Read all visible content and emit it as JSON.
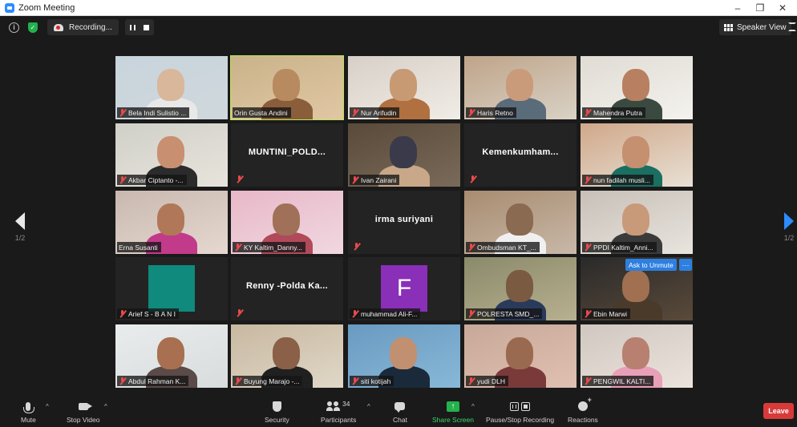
{
  "window": {
    "title": "Zoom Meeting",
    "minimize_icon": "–",
    "maximize_icon": "❐",
    "close_icon": "✕"
  },
  "topbar": {
    "recording_text": "Recording...",
    "speaker_view_label": "Speaker View"
  },
  "pager": {
    "left_page": "1/2",
    "right_page": "1/2"
  },
  "participants": [
    {
      "name": "Bela Indi Sulistio ...",
      "type": "video",
      "muted": true
    },
    {
      "name": "Orin Gusta Andini",
      "type": "video",
      "muted": false,
      "active": true
    },
    {
      "name": "Nur Arifudin",
      "type": "video",
      "muted": true
    },
    {
      "name": "Haris Retno",
      "type": "video",
      "muted": true
    },
    {
      "name": "Mahendra Putra",
      "type": "video",
      "muted": true
    },
    {
      "name": "Akbar Ciptanto -...",
      "type": "video",
      "muted": true
    },
    {
      "name": "MUNTINI_POLD...",
      "type": "name",
      "muted": true
    },
    {
      "name": "Ivan Zairani",
      "type": "video",
      "muted": true
    },
    {
      "name": "Kemenkumham...",
      "type": "name",
      "muted": true
    },
    {
      "name": "nun fadilah musli...",
      "type": "video",
      "muted": true
    },
    {
      "name": "Erna Susanti",
      "type": "video",
      "muted": false
    },
    {
      "name": "KY Kaltim_Danny...",
      "type": "video",
      "muted": true
    },
    {
      "name": "irma suriyani",
      "type": "name",
      "muted": true
    },
    {
      "name": "Ombudsman KT_...",
      "type": "video",
      "muted": true
    },
    {
      "name": "PPDI Kaltim_Anni...",
      "type": "video",
      "muted": true
    },
    {
      "name": "Arief S - B A N I",
      "type": "avatar-teal",
      "muted": true
    },
    {
      "name": "Renny -Polda Ka...",
      "type": "name",
      "muted": true
    },
    {
      "name": "muhammad Ali-F...",
      "type": "avatar-letter",
      "letter": "F",
      "muted": true
    },
    {
      "name": "POLRESTA SMD_...",
      "type": "video",
      "muted": true
    },
    {
      "name": "Ebin Marwi",
      "type": "video",
      "muted": true
    },
    {
      "name": "Abdul Rahman K...",
      "type": "video",
      "muted": true
    },
    {
      "name": "Buyung Marajo -...",
      "type": "video",
      "muted": true
    },
    {
      "name": "siti kotijah",
      "type": "video",
      "muted": true
    },
    {
      "name": "yudi DLH",
      "type": "video",
      "muted": true
    },
    {
      "name": "PENGWIL KALTI...",
      "type": "video",
      "muted": true
    }
  ],
  "hover": {
    "ask_to_unmute": "Ask to Unmute",
    "more": "···"
  },
  "toolbar": {
    "mute": "Mute",
    "stop_video": "Stop Video",
    "security": "Security",
    "participants": "Participants",
    "participants_count": "34",
    "chat": "Chat",
    "share_screen": "Share Screen",
    "pause_stop_recording": "Pause/Stop Recording",
    "reactions": "Reactions",
    "leave": "Leave",
    "caret": "^"
  },
  "colors": {
    "active_outline": "#b9e655",
    "accent_blue": "#2d8cff",
    "share_green": "#23b24c",
    "leave_red": "#d83a3a",
    "avatar_teal": "#0f8a7c",
    "avatar_purple": "#8a2fb8"
  }
}
